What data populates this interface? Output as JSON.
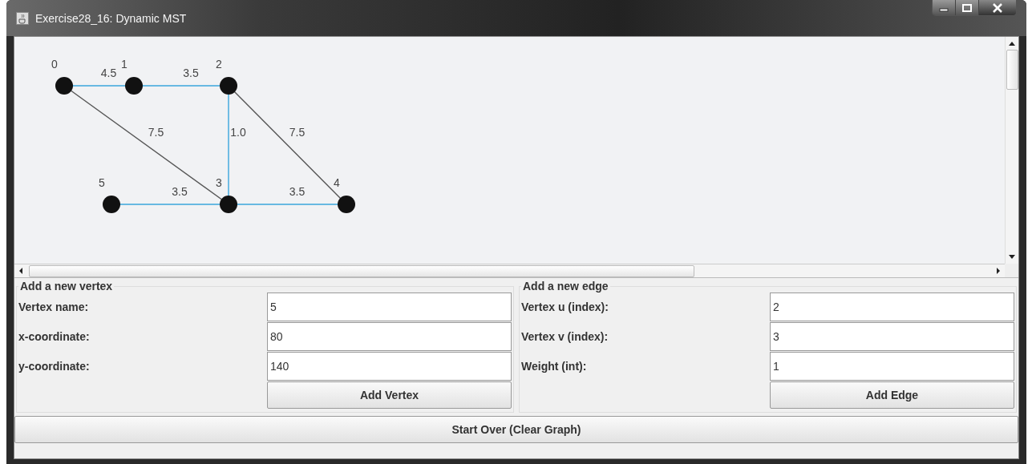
{
  "window": {
    "title": "Exercise28_16: Dynamic MST"
  },
  "graph": {
    "vertices": [
      "0",
      "1",
      "2",
      "5",
      "3",
      "4"
    ],
    "edges": [
      {
        "weight": "4.5",
        "in_mst": true
      },
      {
        "weight": "3.5",
        "in_mst": true
      },
      {
        "weight": "7.5",
        "in_mst": false
      },
      {
        "weight": "1.0",
        "in_mst": true
      },
      {
        "weight": "7.5",
        "in_mst": false
      },
      {
        "weight": "3.5",
        "in_mst": true
      },
      {
        "weight": "3.5",
        "in_mst": true
      }
    ]
  },
  "vertex_panel": {
    "title": "Add a new vertex",
    "fields": [
      {
        "label": "Vertex name:",
        "value": "5"
      },
      {
        "label": "x-coordinate:",
        "value": "80"
      },
      {
        "label": "y-coordinate:",
        "value": "140"
      }
    ],
    "button": "Add Vertex"
  },
  "edge_panel": {
    "title": "Add a new edge",
    "fields": [
      {
        "label": "Vertex u (index):",
        "value": "2"
      },
      {
        "label": "Vertex v (index):",
        "value": "3"
      },
      {
        "label": "Weight (int):",
        "value": "1"
      }
    ],
    "button": "Add Edge"
  },
  "start_over_button": "Start Over (Clear Graph)"
}
